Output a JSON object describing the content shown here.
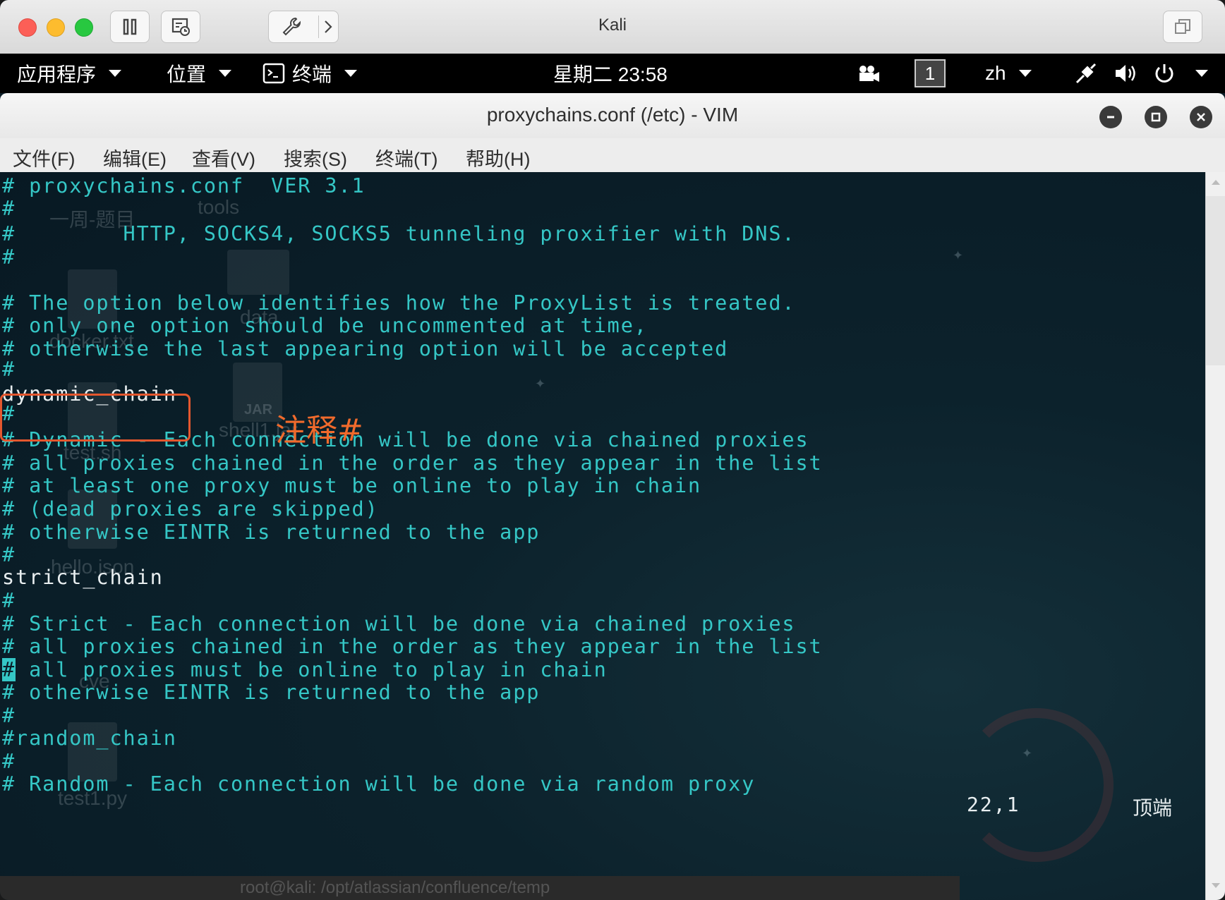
{
  "mac_window": {
    "title": "Kali"
  },
  "panel": {
    "applications": "应用程序",
    "places": "位置",
    "terminal": "终端",
    "clock": "星期二 23:58",
    "workspace": "1",
    "language": "zh"
  },
  "terminal_window": {
    "title": "proxychains.conf (/etc) - VIM",
    "menu": [
      "文件(F)",
      "编辑(E)",
      "查看(V)",
      "搜索(S)",
      "终端(T)",
      "帮助(H)"
    ]
  },
  "vim": {
    "lines": [
      "# proxychains.conf  VER 3.1",
      "#",
      "#        HTTP, SOCKS4, SOCKS5 tunneling proxifier with DNS.",
      "#",
      "",
      "# The option below identifies how the ProxyList is treated.",
      "# only one option should be uncommented at time,",
      "# otherwise the last appearing option will be accepted",
      "#",
      "dynamic_chain",
      "#",
      "# Dynamic - Each connection will be done via chained proxies",
      "# all proxies chained in the order as they appear in the list",
      "# at least one proxy must be online to play in chain",
      "# (dead proxies are skipped)",
      "# otherwise EINTR is returned to the app",
      "#",
      "strict_chain",
      "#",
      "# Strict - Each connection will be done via chained proxies",
      "# all proxies chained in the order as they appear in the list",
      "# all proxies must be online to play in chain",
      "# otherwise EINTR is returned to the app",
      "#",
      "#random_chain",
      "#",
      "# Random - Each connection will be done via random proxy"
    ],
    "cursor_line_rest": " all proxies must be online to play in chain",
    "cursor_char": "#",
    "status_position": "22,1",
    "status_scroll": "顶端"
  },
  "annotation": {
    "text": "注释#",
    "color": "#e4572e"
  },
  "desktop_remnants": {
    "labels": [
      "一周-题目",
      "tools",
      "data",
      "docker.txt",
      "shell1.jar",
      "test.sh",
      "hello.json",
      "cve",
      "test1.py",
      "JAR"
    ],
    "bottom_window_title": "root@kali: /opt/atlassian/confluence/temp"
  }
}
